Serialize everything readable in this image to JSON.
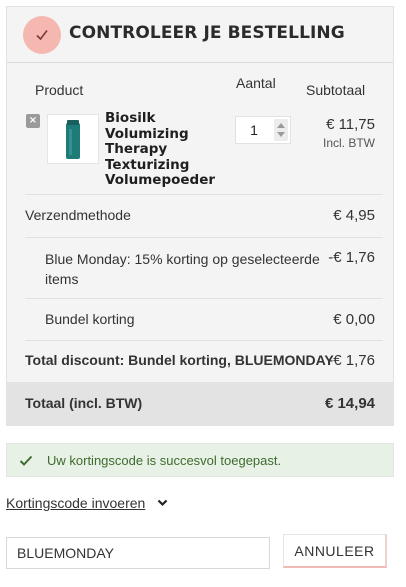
{
  "checkout": {
    "title": "CONTROLEER JE BESTELLING",
    "columns": {
      "product": "Product",
      "quantity": "Aantal",
      "subtotal": "Subtotaal"
    },
    "item": {
      "remove_label": "×",
      "name": "Biosilk Volumizing Therapy Texturizing Volumepoeder",
      "quantity": "1",
      "price": "€ 11,75",
      "vat_note": "Incl. BTW"
    },
    "shipping": {
      "label": "Verzendmethode",
      "amount": "€ 4,95"
    },
    "discounts": [
      {
        "label": "Blue Monday: 15% korting op geselecteerde items",
        "amount": "-€ 1,76"
      },
      {
        "label": "Bundel korting",
        "amount": "€ 0,00"
      }
    ],
    "total_discount": {
      "label": "Total discount: Bundel korting, BLUEMONDAY",
      "amount": "-€ 1,76"
    },
    "total": {
      "label": "Totaal (incl. BTW)",
      "amount": "€ 14,94"
    }
  },
  "notice": {
    "text": "Uw kortingscode is succesvol toegepast."
  },
  "coupon": {
    "toggle_label": "Kortingscode invoeren",
    "value": "BLUEMONDAY",
    "cancel_label": "ANNULEER"
  },
  "colors": {
    "accent_circle": "#f5b8b0",
    "success_bg": "#e8f1e5",
    "success_text": "#3e6b2f"
  },
  "icons": {
    "header": "checkmark-icon",
    "notice": "checkmark-icon",
    "toggle": "chevron-down-icon",
    "remove": "remove-icon"
  }
}
